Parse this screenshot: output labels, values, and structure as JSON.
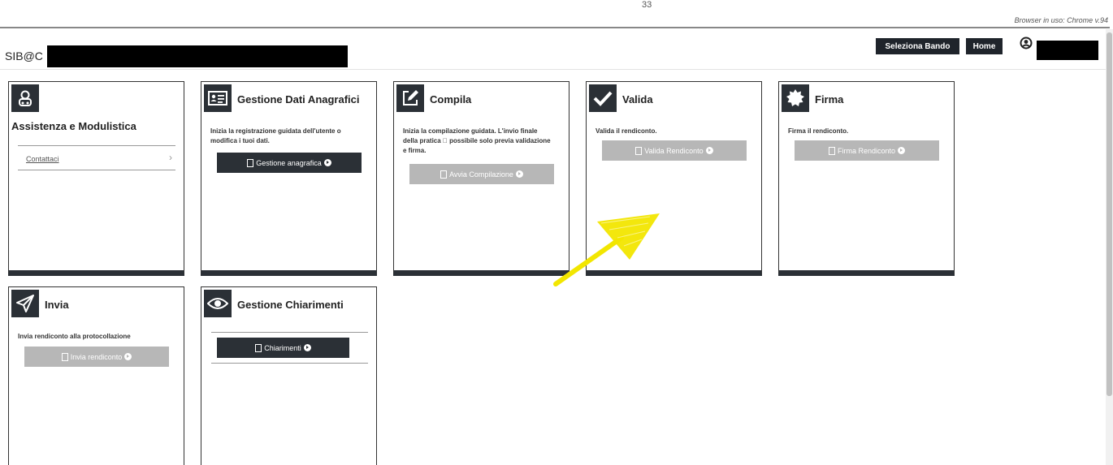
{
  "top": {
    "mark": "33",
    "browser_info": "Browser in uso: Chrome v.94"
  },
  "header": {
    "brand": "SIB@C",
    "buttons": {
      "bando": "Seleziona Bando",
      "home": "Home"
    },
    "icons": {
      "user": "user-circle-icon"
    }
  },
  "cards": {
    "assistenza": {
      "title": "Assistenza e Modulistica",
      "link": "Contattaci",
      "icon": "support-agent-icon"
    },
    "anagrafica": {
      "title": "Gestione Dati Anagrafici",
      "desc": "Inizia la registrazione guidata dell'utente o modifica i tuoi dati.",
      "button": "Gestione anagrafica",
      "icon": "id-card-icon"
    },
    "compila": {
      "title": "Compila",
      "desc": "Inizia la compilazione guidata. L'invio finale della pratica \u0000 possibile solo previa validazione e firma.",
      "button": "Avvia Compilazione",
      "icon": "edit-icon"
    },
    "valida": {
      "title": "Valida",
      "desc": "Valida il rendiconto.",
      "button": "Valida Rendiconto",
      "icon": "check-icon"
    },
    "firma": {
      "title": "Firma",
      "desc": "Firma il rendiconto.",
      "button": "Firma Rendiconto",
      "icon": "seal-icon"
    },
    "invia": {
      "title": "Invia",
      "desc": "Invia rendiconto alla protocollazione",
      "button": "Invia rendiconto",
      "icon": "paper-plane-icon"
    },
    "chiarimenti": {
      "title": "Gestione Chiarimenti",
      "button": "Chiarimenti",
      "icon": "eye-icon"
    }
  },
  "colors": {
    "dark": "#2b3036",
    "disabled": "#b7b7b7",
    "annotation_arrow": "#f2e600"
  }
}
